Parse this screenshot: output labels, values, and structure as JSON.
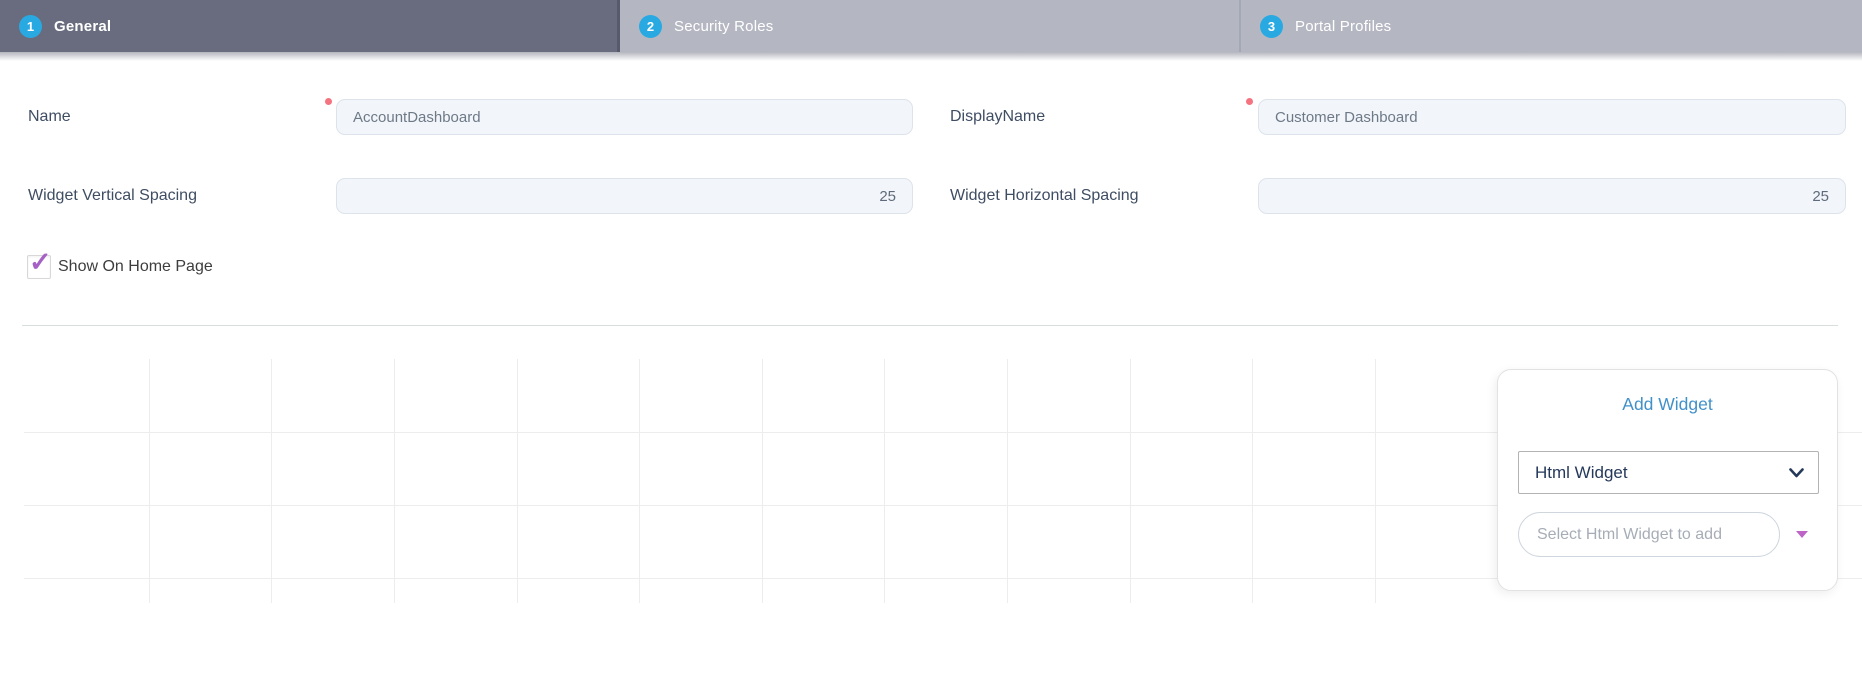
{
  "wizard": {
    "steps": [
      {
        "number": "1",
        "label": "General",
        "active": true
      },
      {
        "number": "2",
        "label": "Security Roles",
        "active": false
      },
      {
        "number": "3",
        "label": "Portal Profiles",
        "active": false
      }
    ]
  },
  "form": {
    "name": {
      "label": "Name",
      "value": "AccountDashboard",
      "required": true
    },
    "display_name": {
      "label": "DisplayName",
      "value": "Customer Dashboard",
      "required": true
    },
    "vertical_spacing": {
      "label": "Widget Vertical Spacing",
      "value": "25"
    },
    "horizontal_spacing": {
      "label": "Widget Horizontal Spacing",
      "value": "25"
    },
    "show_on_home_page": {
      "label": "Show On Home Page",
      "checked": true,
      "checkmark_glyph": "✓"
    }
  },
  "add_widget_panel": {
    "title": "Add Widget",
    "widget_type_selected": "Html Widget",
    "widget_select_placeholder": "Select Html Widget to add"
  },
  "colors": {
    "active_tab_bg": "#686c7e",
    "inactive_tab_bg": "#b4b7c2",
    "step_circle_blue": "#29a9e2",
    "link_blue": "#4191c9",
    "required_dot_red": "#f4737f",
    "checkmark_purple": "#a661c4",
    "caret_purple": "#bd64c6",
    "input_bg": "#f2f6fa",
    "gridline_gray": "#ededed"
  }
}
